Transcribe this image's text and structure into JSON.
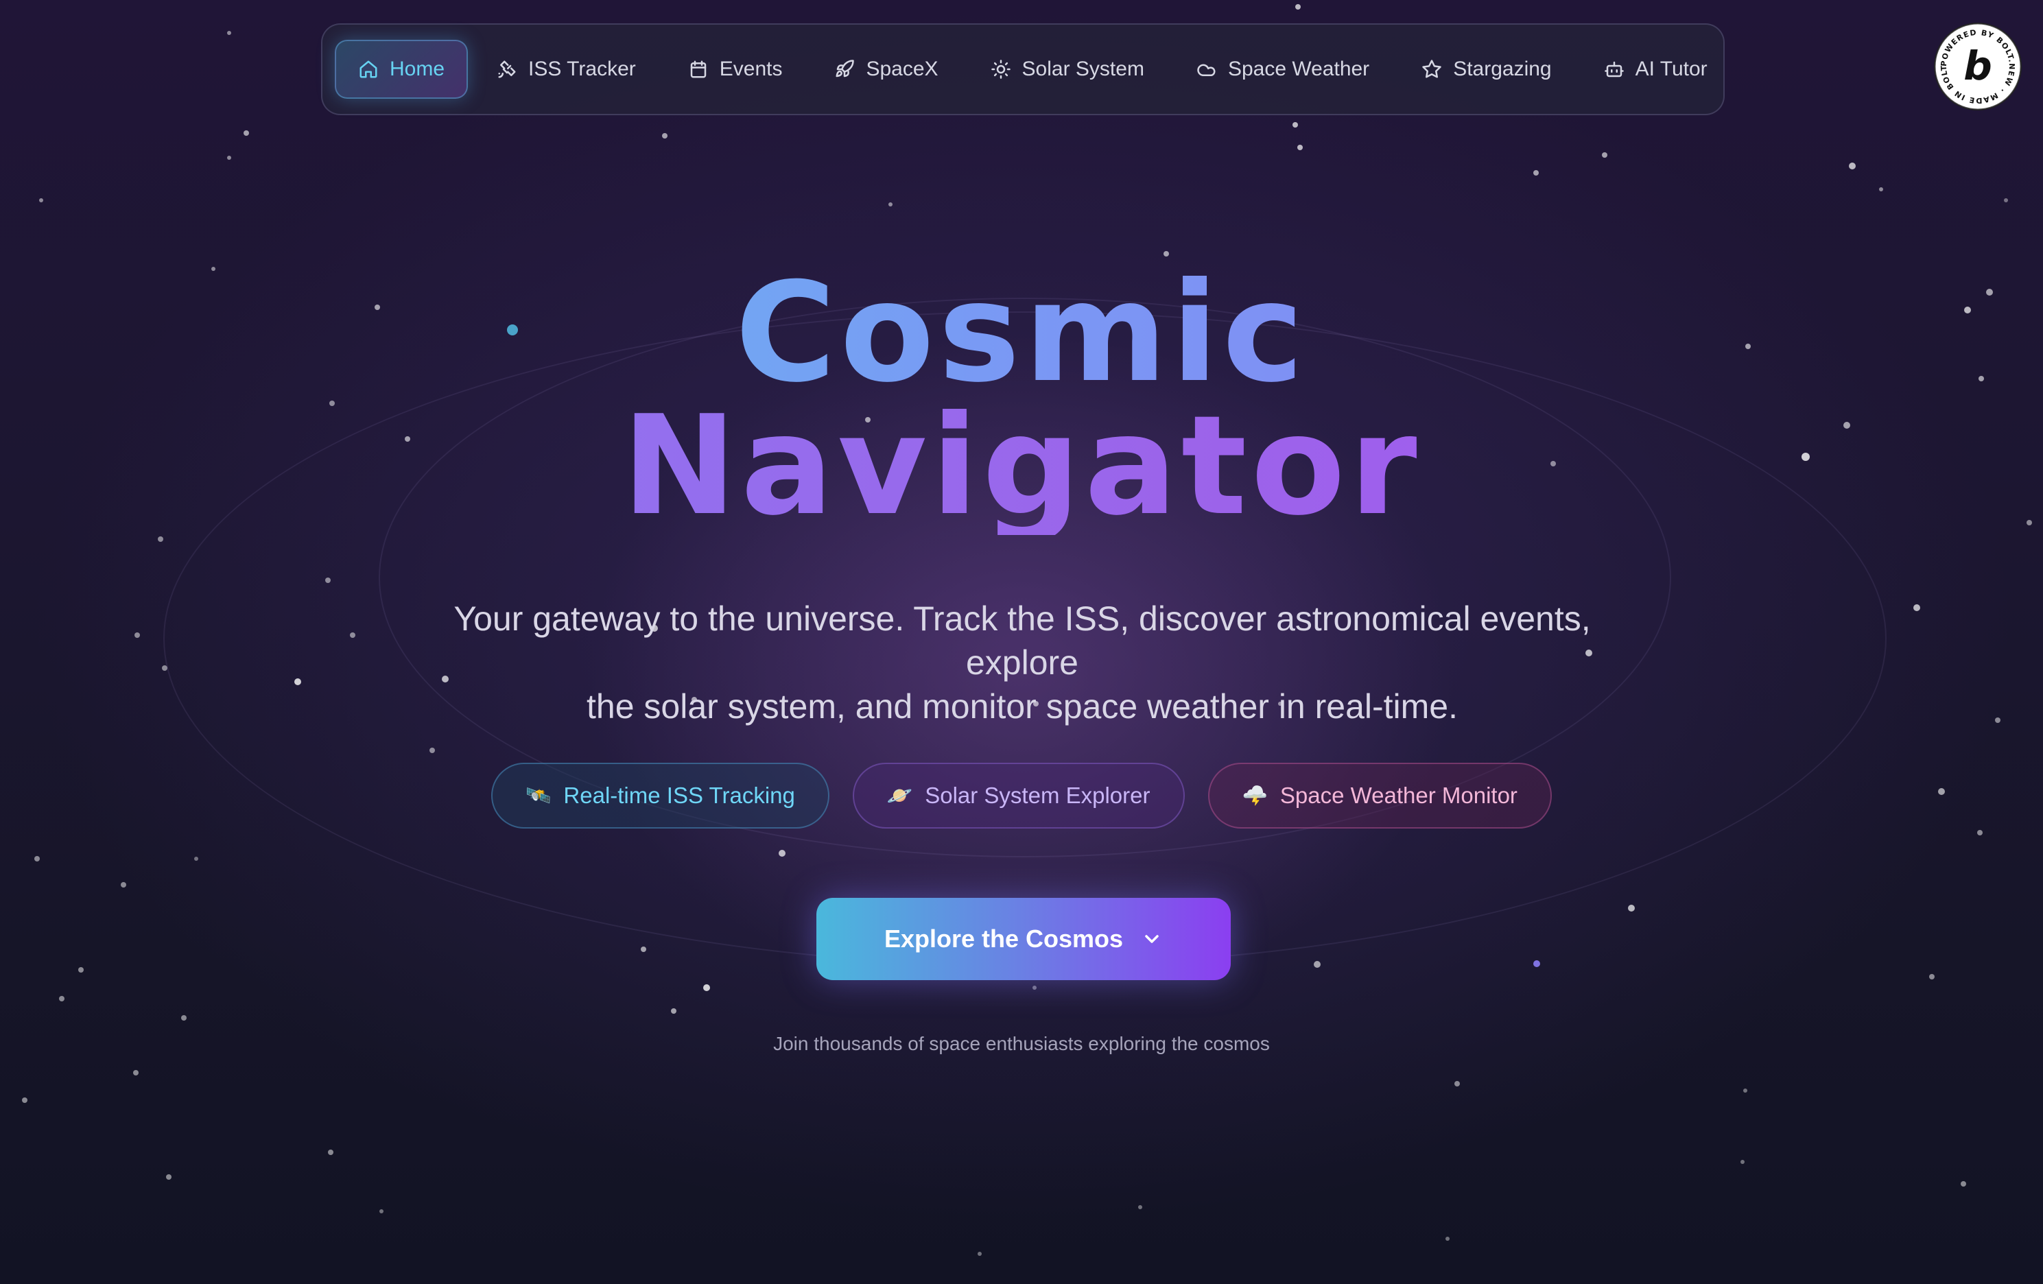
{
  "nav": {
    "items": [
      {
        "label": "Home",
        "icon": "home-icon",
        "active": true
      },
      {
        "label": "ISS Tracker",
        "icon": "satellite-icon",
        "active": false
      },
      {
        "label": "Events",
        "icon": "calendar-icon",
        "active": false
      },
      {
        "label": "SpaceX",
        "icon": "rocket-icon",
        "active": false
      },
      {
        "label": "Solar System",
        "icon": "sun-icon",
        "active": false
      },
      {
        "label": "Space Weather",
        "icon": "cloud-icon",
        "active": false
      },
      {
        "label": "Stargazing",
        "icon": "star-icon",
        "active": false
      },
      {
        "label": "AI Tutor",
        "icon": "bot-icon",
        "active": false
      }
    ]
  },
  "badge": {
    "ring_text": "POWERED BY BOLT.NEW · MADE IN BOLT.NEW ·",
    "letter": "b"
  },
  "hero": {
    "title_line1": "Cosmic",
    "title_line2": "Navigator",
    "subtitle_line1": "Your gateway to the universe. Track the ISS, discover astronomical events,",
    "subtitle_line2": "explore",
    "subtitle_line3": "the solar system, and monitor space weather in real-time.",
    "chips": [
      {
        "emoji": "🛰️",
        "label": "Real-time ISS Tracking"
      },
      {
        "emoji": "🪐",
        "label": "Solar System Explorer"
      },
      {
        "emoji": "🌩️",
        "label": "Space Weather Monitor"
      }
    ],
    "cta_label": "Explore the Cosmos",
    "cta_icon": "chevron-down-icon",
    "footnote": "Join thousands of space enthusiasts exploring the cosmos"
  },
  "colors": {
    "accent_cyan": "#67d3f2",
    "accent_purple": "#8b3ff0",
    "background": "#1c1631"
  }
}
